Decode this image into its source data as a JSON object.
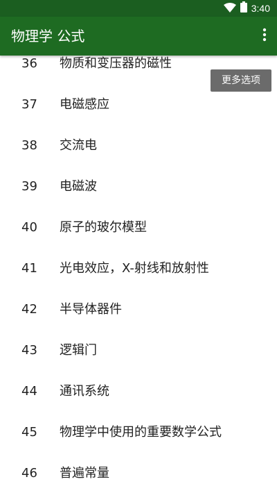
{
  "status_bar": {
    "time": "3:40",
    "wifi_icon": "wifi-icon",
    "battery_icon": "battery-icon"
  },
  "app_bar": {
    "title": "物理学 公式",
    "overflow_icon": "more-vert-icon",
    "tooltip": "更多选项"
  },
  "colors": {
    "status_bar": "#1b5e20",
    "app_bar": "#1e6b22",
    "tooltip": "#6b6b6b",
    "text": "#222222"
  },
  "chapters": [
    {
      "num": "36",
      "title": "物质和变压器的磁性"
    },
    {
      "num": "37",
      "title": "电磁感应"
    },
    {
      "num": "38",
      "title": "交流电"
    },
    {
      "num": "39",
      "title": "电磁波"
    },
    {
      "num": "40",
      "title": "原子的玻尔模型"
    },
    {
      "num": "41",
      "title": "光电效应，X-射线和放射性"
    },
    {
      "num": "42",
      "title": "半导体器件"
    },
    {
      "num": "43",
      "title": "逻辑门"
    },
    {
      "num": "44",
      "title": "通讯系统"
    },
    {
      "num": "45",
      "title": "物理学中使用的重要数学公式"
    },
    {
      "num": "46",
      "title": "普遍常量"
    }
  ]
}
